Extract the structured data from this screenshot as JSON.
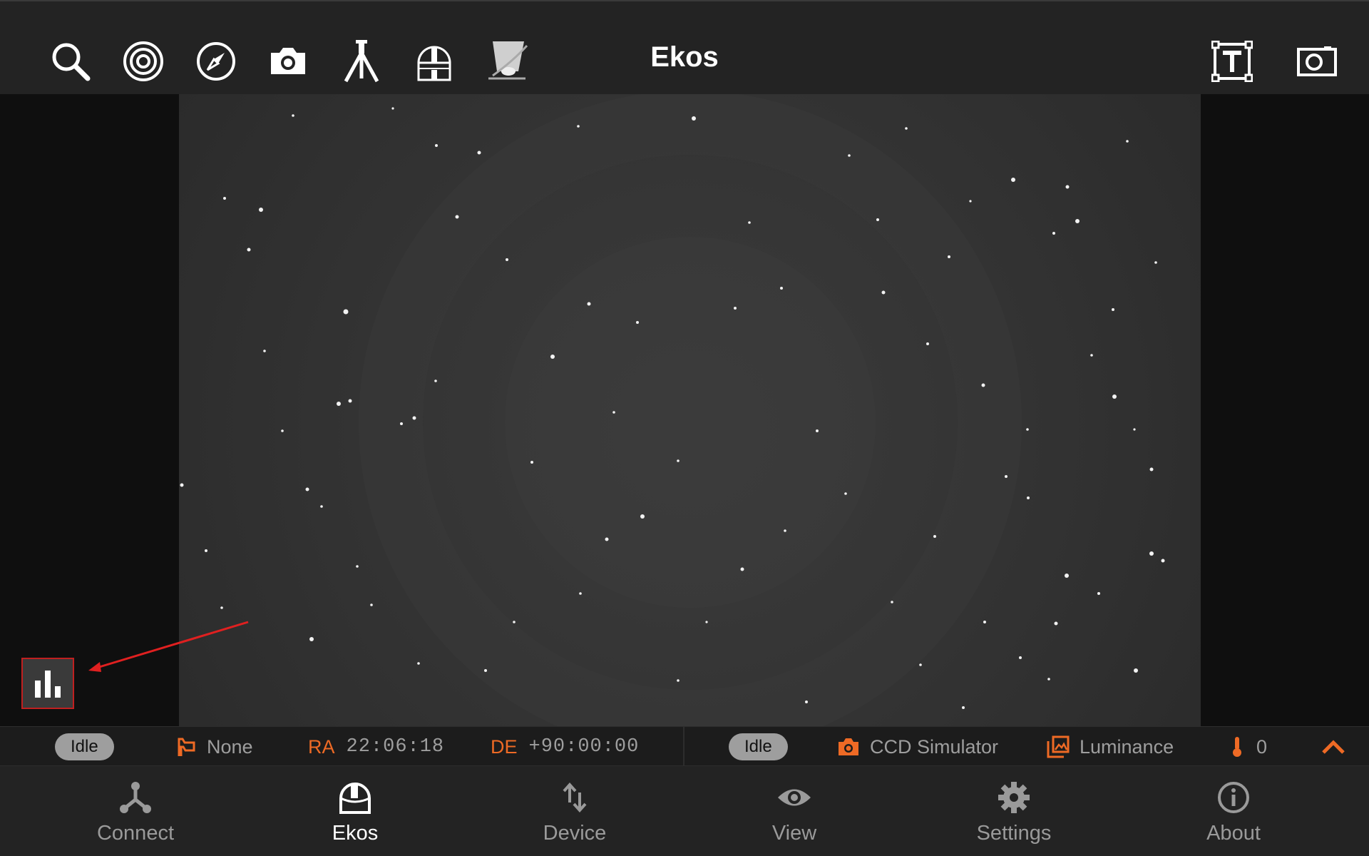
{
  "toolbar": {
    "title": "Ekos",
    "left_tools": [
      {
        "icon": "search-icon",
        "label": "Search"
      },
      {
        "icon": "target-icon",
        "label": "Align"
      },
      {
        "icon": "compass-icon",
        "label": "Mount"
      },
      {
        "icon": "camera-icon",
        "label": "Capture"
      },
      {
        "icon": "tripod-icon",
        "label": "Telescope"
      },
      {
        "icon": "observatory-icon",
        "label": "Dome"
      },
      {
        "icon": "telescope-icon",
        "label": "Guide"
      }
    ],
    "right_tools": [
      {
        "icon": "text-overlay-icon"
      },
      {
        "icon": "screenshot-icon"
      }
    ]
  },
  "status_left": {
    "state": "Idle",
    "target": "None",
    "ra_label": "RA",
    "ra_value": "22:06:18",
    "de_label": "DE",
    "de_value": "+90:00:00"
  },
  "status_right": {
    "state": "Idle",
    "camera": "CCD Simulator",
    "filter": "Luminance",
    "temperature": "0"
  },
  "nav": [
    {
      "id": "connect",
      "label": "Connect",
      "icon": "connect-icon"
    },
    {
      "id": "ekos",
      "label": "Ekos",
      "icon": "observatory-dome-icon",
      "active": true
    },
    {
      "id": "device",
      "label": "Device",
      "icon": "swap-vertical-icon"
    },
    {
      "id": "view",
      "label": "View",
      "icon": "eye-icon"
    },
    {
      "id": "settings",
      "label": "Settings",
      "icon": "gear-icon"
    },
    {
      "id": "about",
      "label": "About",
      "icon": "info-icon"
    }
  ],
  "colors": {
    "accent": "#ee6a25",
    "toolbar_bg": "#232323",
    "highlight_box": "#c02020"
  }
}
